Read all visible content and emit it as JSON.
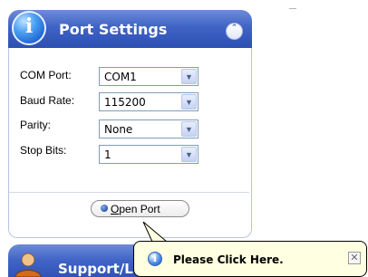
{
  "port_settings": {
    "title": "Port Settings",
    "collapse_glyph": "⌃",
    "fields": [
      {
        "label": "COM Port:",
        "value": "COM1"
      },
      {
        "label": "Baud Rate:",
        "value": "115200"
      },
      {
        "label": "Parity:",
        "value": "None"
      },
      {
        "label": "Stop Bits:",
        "value": "1"
      }
    ],
    "open_button": {
      "accel": "O",
      "rest": "pen Port"
    }
  },
  "support_panel": {
    "title_visible": "Support/Li"
  },
  "balloon": {
    "text": "Please Click Here.",
    "close_glyph": "✕"
  },
  "icons": {
    "header": "info-icon",
    "collapse": "chevron-up-icon",
    "dropdown": "chevron-down-icon",
    "support": "user-avatar-icon",
    "balloon": "info-icon",
    "close": "close-icon"
  },
  "colors": {
    "header_blue": "#3f63c6",
    "panel_border": "#b8c4e6",
    "balloon_bg": "#ffffe1"
  }
}
